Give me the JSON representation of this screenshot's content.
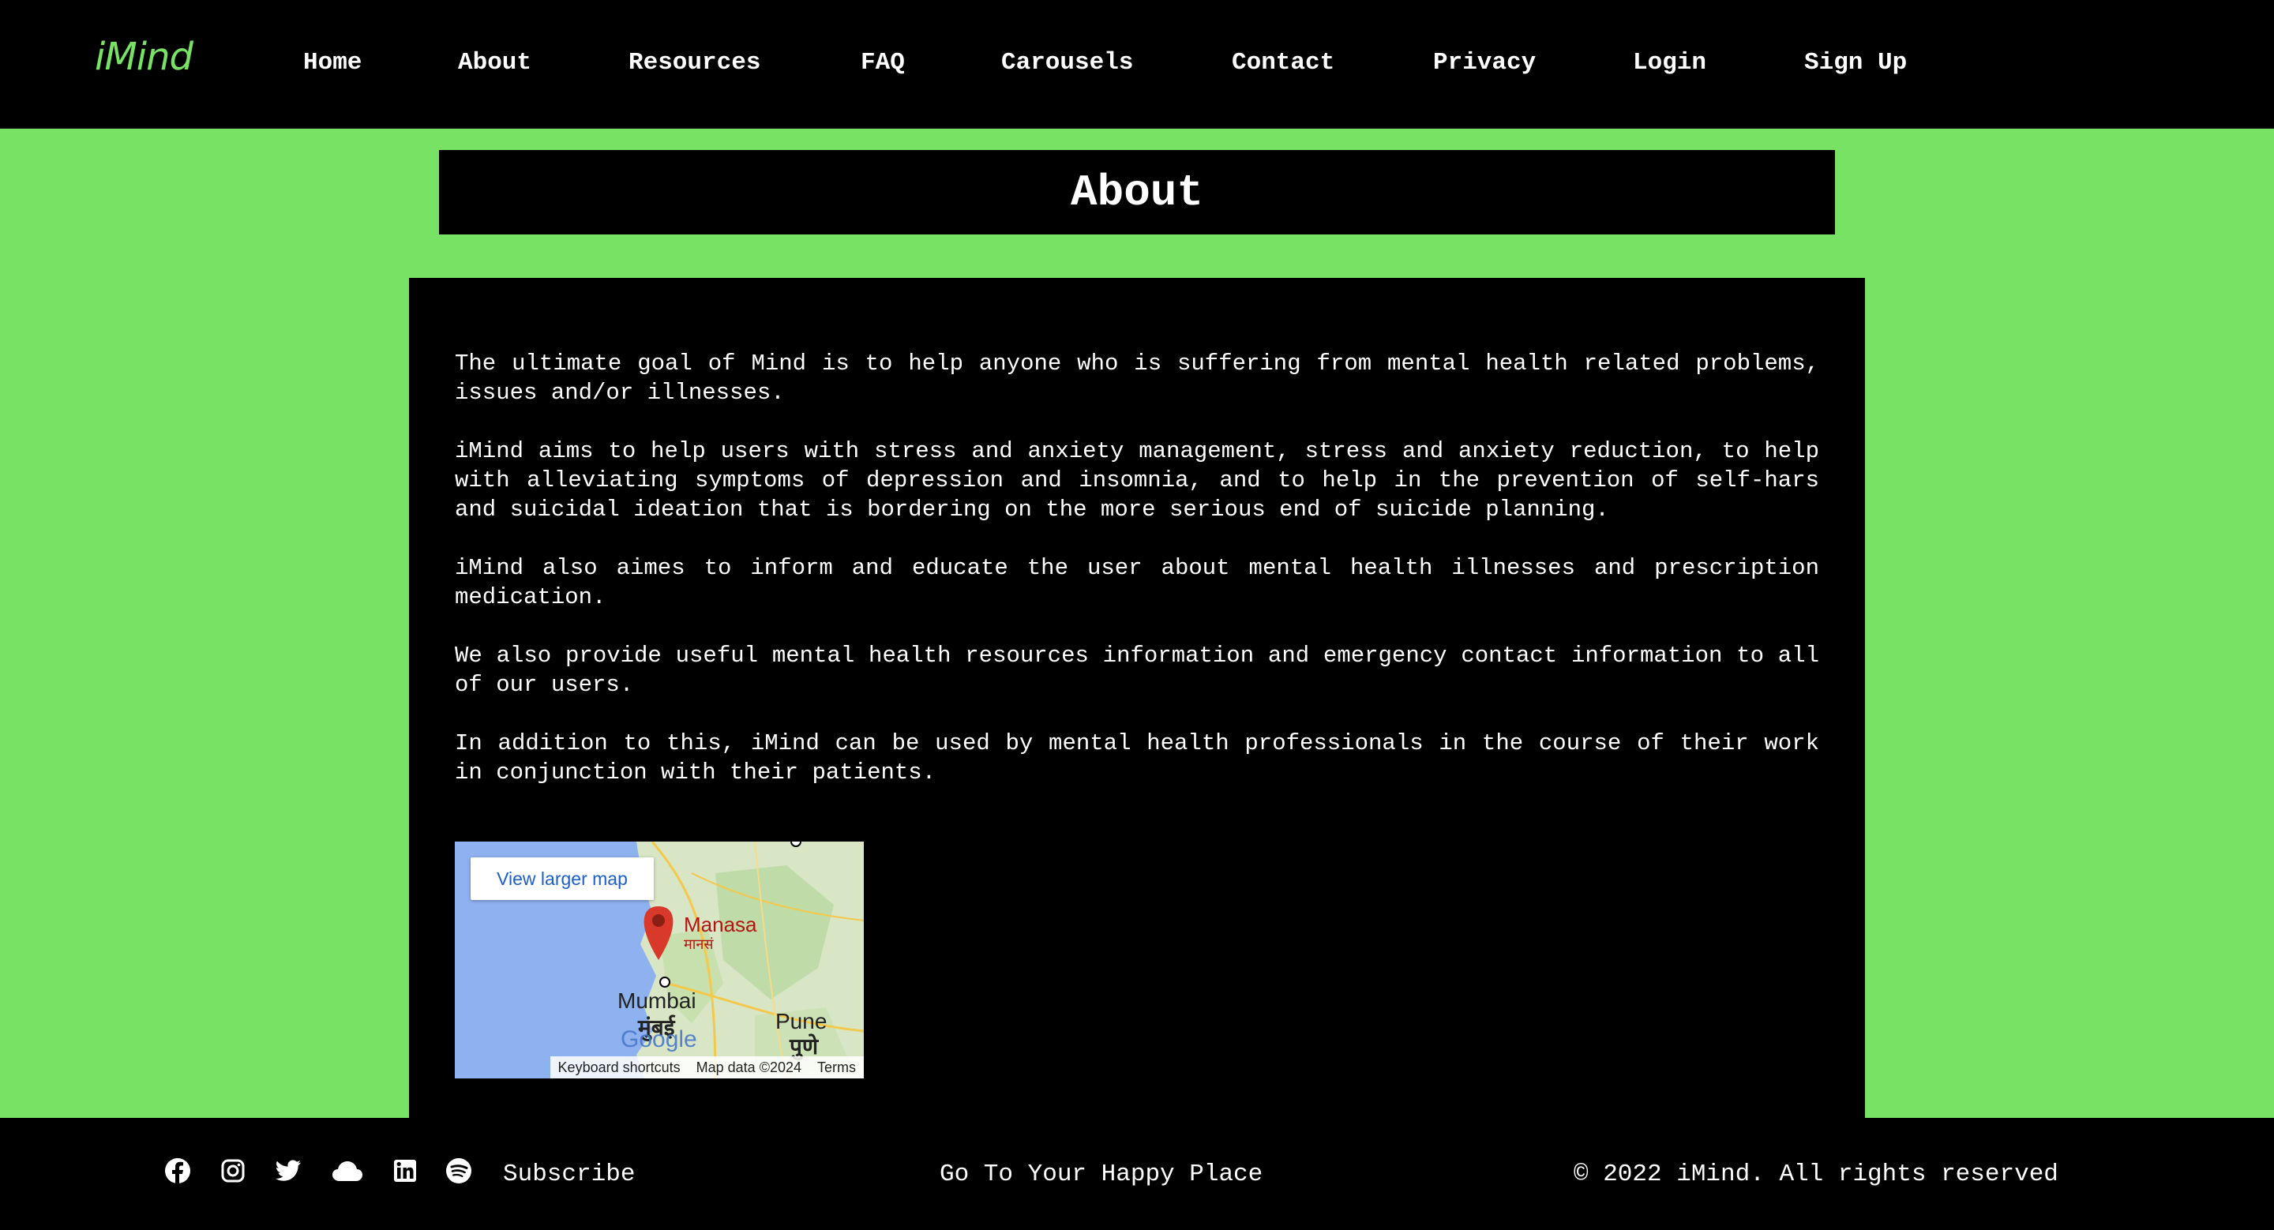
{
  "header": {
    "logo": "iMind",
    "nav": [
      "Home",
      "About",
      "Resources",
      "FAQ",
      "Carousels",
      "Contact",
      "Privacy",
      "Login",
      "Sign Up"
    ]
  },
  "page_title": "About",
  "content": {
    "paragraphs": [
      "The ultimate goal of Mind is to help anyone who is suffering from mental health related problems, issues and/or illnesses.",
      "iMind aims to help users with stress and anxiety management, stress and anxiety reduction, to help with alleviating symptoms of depression and insomnia, and to help in the prevention of self-hars and suicidal ideation that is bordering on the more serious end of suicide planning.",
      "iMind also aimes to inform and educate the user about mental health illnesses and prescription medication.",
      "We also provide useful mental health resources information and emergency contact information to all of our users.",
      "In addition to this, iMind can be used by mental health professionals in the course of their work in conjunction with their patients."
    ]
  },
  "map": {
    "button": "View larger map",
    "place_name": "Manasa",
    "place_name_local": "मानसं",
    "city1": "Mumbai",
    "city1_local": "मुंबई",
    "city2": "Pune",
    "city2_local": "पुणे",
    "google": "Google",
    "keyboard": "Keyboard shortcuts",
    "mapdata": "Map data ©2024",
    "terms": "Terms"
  },
  "footer": {
    "icons": [
      "facebook-icon",
      "instagram-icon",
      "twitter-icon",
      "cloud-icon",
      "linkedin-icon",
      "spotify-icon"
    ],
    "subscribe": "Subscribe",
    "tagline": "Go To Your Happy Place",
    "copyright": "© 2022 iMind. All rights reserved"
  },
  "colors": {
    "accent": "#78e264",
    "background_dark": "#000000",
    "text": "#ffffff"
  }
}
